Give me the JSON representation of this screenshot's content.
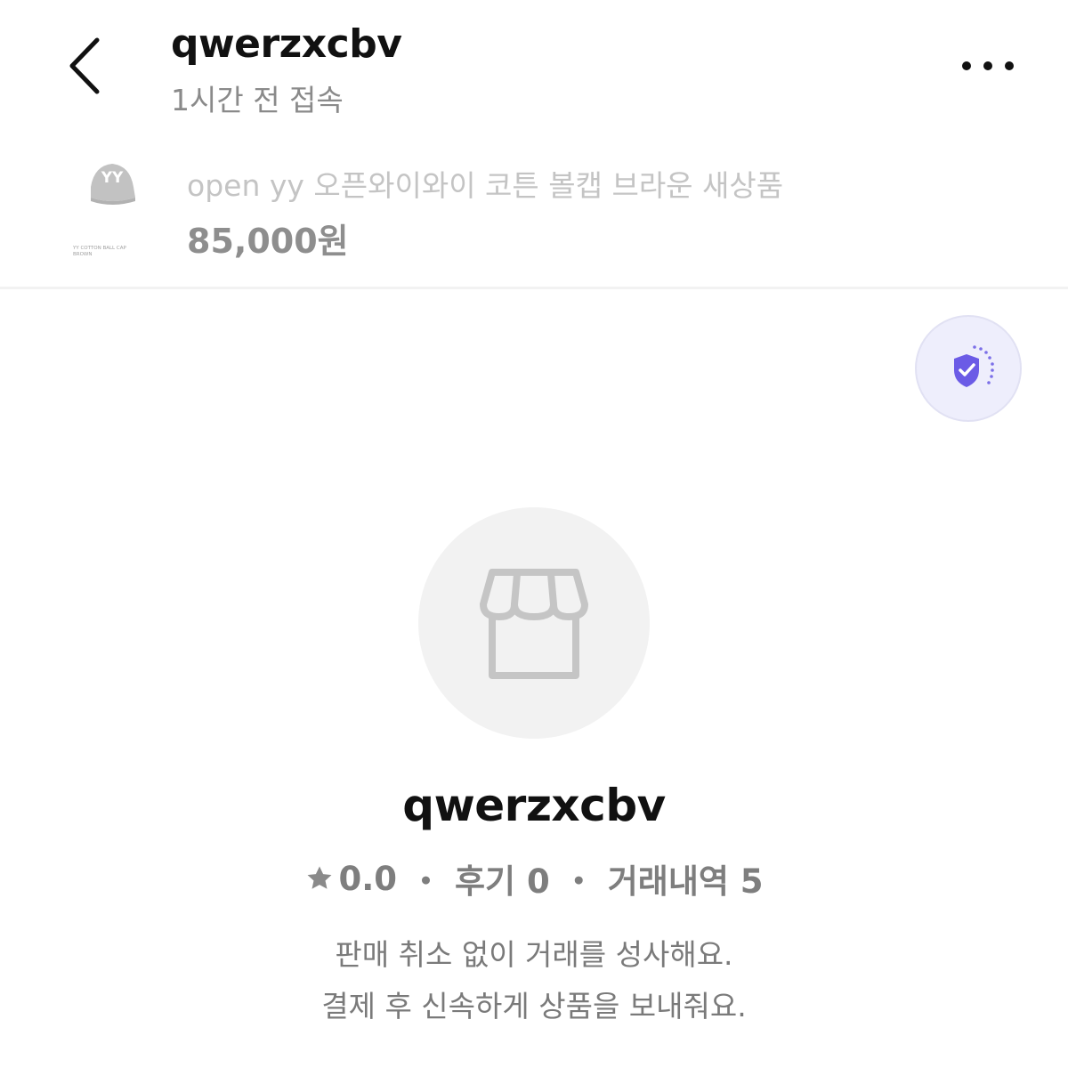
{
  "header": {
    "title": "qwerzxcbv",
    "status": "1시간 전 접속",
    "back_icon": "chevron-left-icon",
    "more_icon": "more-horizontal-icon"
  },
  "product": {
    "title": "open yy 오픈와이와이 코튼 볼캡 브라운 새상품",
    "price": "85,000원",
    "thumb_logo": "YY",
    "thumb_caption_1": "YY COTTON BALL CAP",
    "thumb_caption_2": "BROWN"
  },
  "safe_badge": {
    "icon": "shield-check-icon",
    "color": "#6b5be6"
  },
  "shop": {
    "avatar_icon": "storefront-icon",
    "name": "qwerzxcbv",
    "rating": "0.0",
    "sep": "・",
    "reviews": "후기 0",
    "transactions": "거래내역 5",
    "desc_1": "판매 취소 없이 거래를 성사해요.",
    "desc_2": "결제 후 신속하게 상품을 보내줘요."
  },
  "colors": {
    "accent": "#6b5be6",
    "badge_bg": "#eeeefc",
    "muted_text": "#7e7e7e"
  }
}
